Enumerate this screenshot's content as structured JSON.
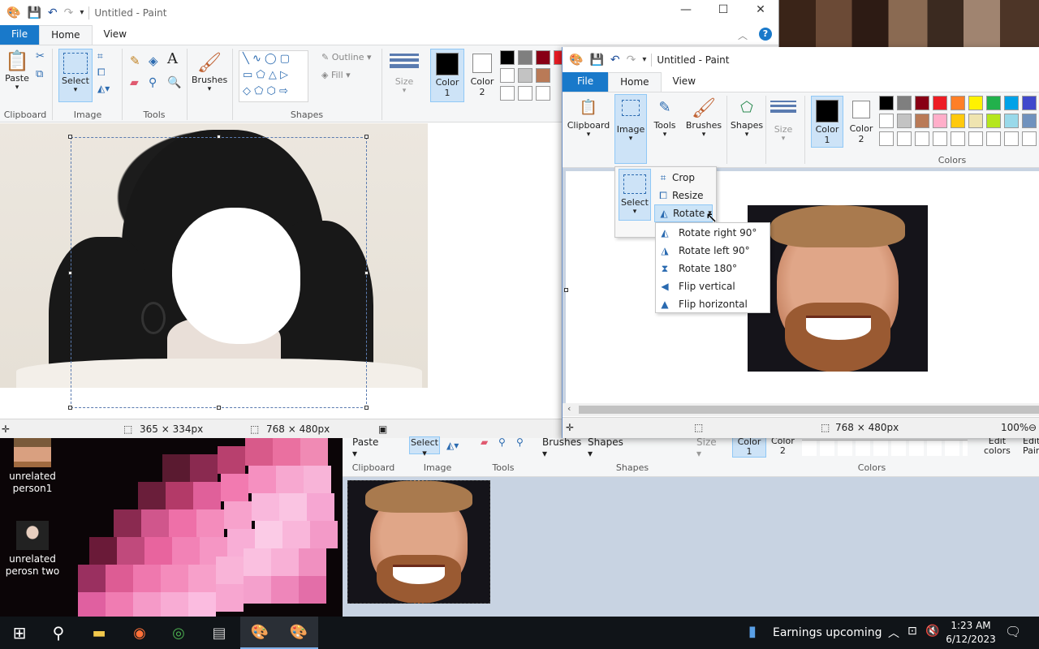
{
  "window1": {
    "title": "Untitled - Paint",
    "tabs": [
      "File",
      "Home",
      "View"
    ],
    "groups": {
      "clipboard": {
        "label": "Clipboard",
        "paste": "Paste"
      },
      "image": {
        "label": "Image",
        "select": "Select"
      },
      "tools": {
        "label": "Tools"
      },
      "brushes": "Brushes",
      "shapes": {
        "label": "Shapes",
        "outline": "Outline",
        "fill": "Fill"
      },
      "size": "Size",
      "color1": "Color",
      "color1_num": "1",
      "color2": "Color",
      "color2_num": "2"
    },
    "status": {
      "selection_size": "365 × 334px",
      "canvas_size": "768 × 480px"
    }
  },
  "window2": {
    "title": "Untitled - Paint",
    "tabs": [
      "File",
      "Home",
      "View"
    ],
    "groups": {
      "clipboard": "Clipboard",
      "image": "Image",
      "tools": "Tools",
      "brushes": "Brushes",
      "shapes": "Shapes",
      "size": "Size",
      "color1": "Color",
      "color1_num": "1",
      "color2": "Color",
      "color2_num": "2",
      "colors_label": "Colors"
    },
    "image_menu": {
      "select": "Select",
      "crop": "Crop",
      "resize": "Resize",
      "rotate": "Rotate"
    },
    "rotate_menu": [
      "Rotate right 90°",
      "Rotate left 90°",
      "Rotate 180°",
      "Flip vertical",
      "Flip horizontal"
    ],
    "status": {
      "canvas_size": "768 × 480px",
      "zoom": "100%"
    }
  },
  "window3": {
    "buttons": {
      "paste": "Paste",
      "select": "Select",
      "brushes": "Brushes",
      "shapes": "Shapes",
      "size": "Size",
      "color1": "Color",
      "color1_num": "1",
      "color2": "Color",
      "color2_num": "2",
      "edit_colors_1": "Edit",
      "edit_colors_2": "colors",
      "edit_paint_1": "Edit",
      "edit_paint_2": "Pain"
    },
    "groups": {
      "clipboard": "Clipboard",
      "image": "Image",
      "tools": "Tools",
      "shapes": "Shapes",
      "colors": "Colors"
    }
  },
  "desktop": {
    "icons": [
      {
        "label_1": "unrelated",
        "label_2": "person1"
      },
      {
        "label_1": "unrelated",
        "label_2": "perosn two"
      }
    ]
  },
  "taskbar": {
    "news": "Earnings upcoming",
    "time": "1:23 AM",
    "date": "6/12/2023"
  },
  "colors": {
    "accent": "#1979ca",
    "palette": [
      "#000000",
      "#7f7f7f",
      "#880015",
      "#ed1c24",
      "#ff7f27",
      "#fff200",
      "#22b14c",
      "#00a2e8",
      "#3f48cc",
      "#ffffff",
      "#c3c3c3",
      "#b97a57",
      "#ffaec9",
      "#ffc90e",
      "#efe4b0",
      "#b5e61d",
      "#99d9ea",
      "#7092be"
    ]
  }
}
